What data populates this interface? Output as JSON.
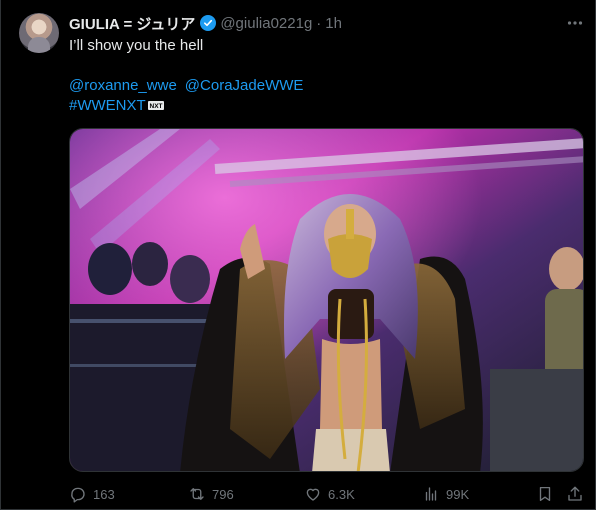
{
  "post": {
    "author": {
      "name": "GIULIA = ジュリア",
      "handle": "@giulia0221g",
      "separator": "·",
      "time": "1h"
    },
    "text_line": "I’ll show you the hell",
    "mentions": [
      "@roxanne_wwe",
      "@CoraJadeWWE"
    ],
    "hashtag": "#WWENXT",
    "hashtag_badge": "NXT"
  },
  "metrics": {
    "replies": "163",
    "reposts": "796",
    "likes": "6.3K",
    "views": "99K"
  },
  "icons": {
    "more": "more-horizontal-icon",
    "verified": "verified-badge-icon",
    "reply": "reply-icon",
    "repost": "repost-icon",
    "like": "heart-icon",
    "views": "views-chart-icon",
    "bookmark": "bookmark-icon",
    "share": "share-icon"
  },
  "colors": {
    "background": "#000000",
    "text": "#e7e9ea",
    "secondary": "#71767b",
    "link": "#1d9bf0",
    "verified": "#1d9bf0"
  }
}
